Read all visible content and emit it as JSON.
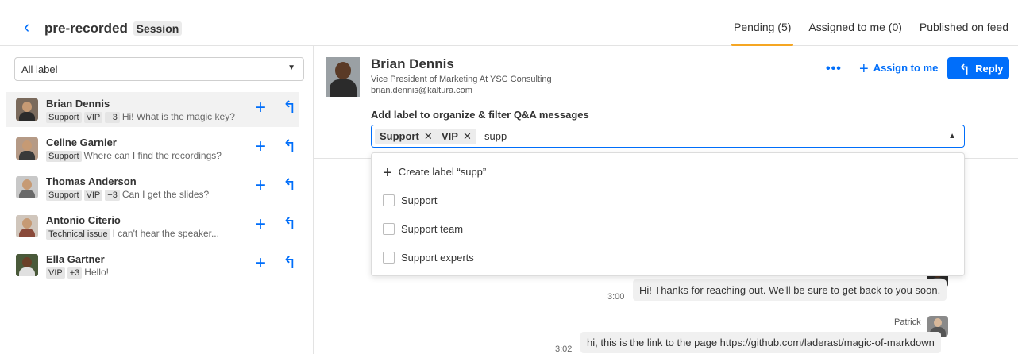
{
  "header": {
    "back_icon": "chevron-left-icon",
    "title": "pre-recorded",
    "title_badge": "Session",
    "tabs": [
      {
        "label": "Pending (5)",
        "active": true
      },
      {
        "label": "Assigned to me (0)",
        "active": false
      },
      {
        "label": "Published on feed",
        "active": false
      }
    ]
  },
  "filter": {
    "value": "All label"
  },
  "threads": [
    {
      "name": "Brian Dennis",
      "tags": [
        "Support",
        "VIP"
      ],
      "more": "+3",
      "text": "Hi! What is the magic key?"
    },
    {
      "name": "Celine Garnier",
      "tags": [
        "Support"
      ],
      "more": "",
      "text": "Where can I find the recordings?"
    },
    {
      "name": "Thomas Anderson",
      "tags": [
        "Support",
        "VIP"
      ],
      "more": "+3",
      "text": "Can I get the slides?"
    },
    {
      "name": "Antonio Citerio",
      "tags": [
        "Technical issue"
      ],
      "more": "",
      "text": "I can't hear the speaker..."
    },
    {
      "name": "Ella Gartner",
      "tags": [
        "VIP"
      ],
      "more": "+3",
      "text": "Hello!"
    }
  ],
  "detail": {
    "name": "Brian Dennis",
    "role": "Vice President of Marketing At YSC Consulting",
    "email": "brian.dennis@kaltura.com",
    "more_label": "•••",
    "assign_label": "Assign to me",
    "reply_label": "Reply",
    "label_help": "Add label to organize & filter Q&A messages",
    "selected_labels": [
      "Support",
      "VIP"
    ],
    "typed": "supp"
  },
  "dropdown": {
    "create": "Create label “supp”",
    "options": [
      "Support",
      "Support team",
      "Support experts"
    ]
  },
  "messages": [
    {
      "time": "3:00",
      "text": "Hi! Thanks for reaching out. We'll be sure to get back to you soon.",
      "sender": ""
    },
    {
      "time": "3:02",
      "text": "hi, this is the link to the page https://github.com/laderast/magic-of-markdown",
      "sender": "Patrick"
    }
  ],
  "colors": {
    "accent": "#006efa",
    "tab_underline": "#f5a623",
    "chip_bg": "#e5e5e5"
  }
}
